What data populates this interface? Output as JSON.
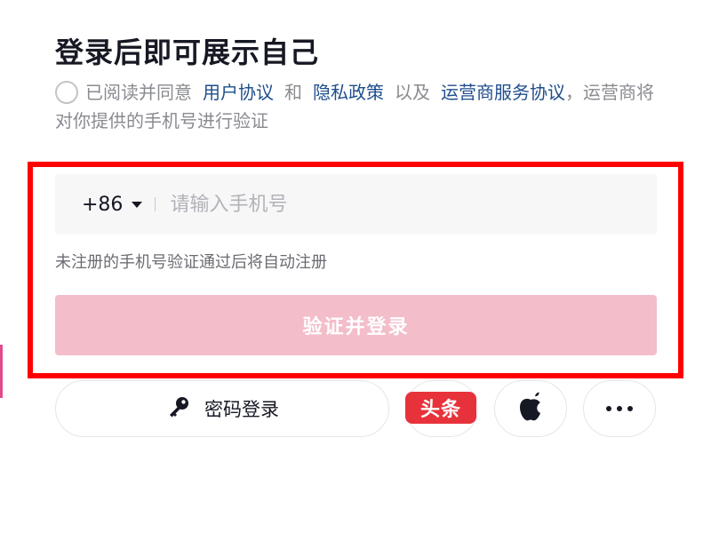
{
  "title": "登录后即可展示自己",
  "agreement": {
    "prefix": "已阅读并同意",
    "user_agreement": "用户协议",
    "and": "和",
    "privacy_policy": "隐私政策",
    "also": "以及",
    "carrier_agreement": "运营商服务协议",
    "suffix": "，运营商将对你提供的手机号进行验证"
  },
  "phone": {
    "country_code": "+86",
    "placeholder": "请输入手机号",
    "value": ""
  },
  "hint": "未注册的手机号验证通过后将自动注册",
  "submit_label": "验证并登录",
  "password_login_label": "密码登录",
  "third_party": {
    "toutiao_label": "头条"
  },
  "icons": {
    "key": "key-icon",
    "apple": "apple-icon",
    "more": "more-icon"
  },
  "colors": {
    "submit_bg": "#f3bdca",
    "link": "#1f4e8c",
    "toutiao": "#e8323b",
    "highlight": "#ff0000"
  }
}
